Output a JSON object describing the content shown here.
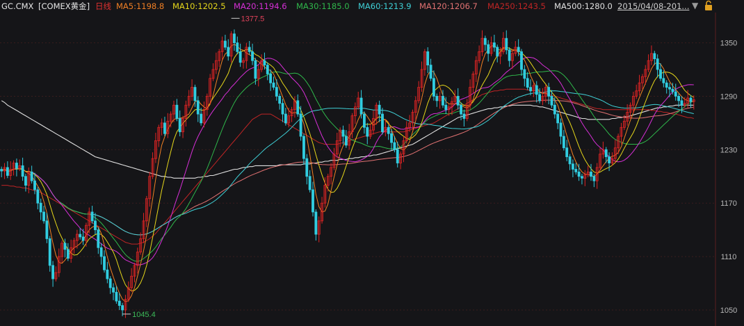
{
  "header": {
    "symbol": "GC.CMX",
    "exchange": "[COMEX黄金]",
    "period": "日线",
    "date_range": "2015/04/08-201..."
  },
  "legend": [
    {
      "label": "MA5:1198.8",
      "color": "#f07f24"
    },
    {
      "label": "MA10:1202.5",
      "color": "#e6d71b"
    },
    {
      "label": "MA20:1194.6",
      "color": "#d72fd7"
    },
    {
      "label": "MA30:1185.0",
      "color": "#2fb74b"
    },
    {
      "label": "MA60:1213.9",
      "color": "#3fd0d6"
    },
    {
      "label": "MA120:1206.7",
      "color": "#e27272"
    },
    {
      "label": "MA250:1243.5",
      "color": "#c02525"
    },
    {
      "label": "MA500:1280.0",
      "color": "#e0e0e0"
    }
  ],
  "colors": {
    "background": "#151518",
    "grid": "#3a1d1d",
    "axis_text": "#b8b8b8",
    "up": "#e02424",
    "down": "#31cde0",
    "high_label": "#e0425a",
    "low_label": "#3cbb58"
  },
  "icons": {
    "dropdown": "dropdown-triangle-icon",
    "lock": "lock-icon"
  },
  "chart_data": {
    "type": "candlestick",
    "y_ticks": [
      1050,
      1110,
      1170,
      1230,
      1290,
      1350
    ],
    "ylim": [
      1032,
      1384
    ],
    "grid": true,
    "annotations": [
      {
        "text": "1377.5",
        "kind": "period-high",
        "x_index": 76
      },
      {
        "text": "1045.4",
        "kind": "period-low",
        "x_index": 40
      }
    ],
    "series_close": [
      1206,
      1210,
      1201,
      1208,
      1215,
      1209,
      1212,
      1200,
      1190,
      1205,
      1195,
      1185,
      1170,
      1160,
      1150,
      1130,
      1100,
      1085,
      1092,
      1110,
      1125,
      1118,
      1108,
      1120,
      1128,
      1135,
      1132,
      1128,
      1145,
      1160,
      1150,
      1140,
      1120,
      1110,
      1095,
      1085,
      1075,
      1070,
      1060,
      1055,
      1050,
      1062,
      1075,
      1088,
      1100,
      1115,
      1130,
      1150,
      1175,
      1200,
      1220,
      1240,
      1255,
      1260,
      1248,
      1262,
      1270,
      1280,
      1265,
      1250,
      1265,
      1280,
      1290,
      1300,
      1285,
      1270,
      1260,
      1275,
      1290,
      1310,
      1320,
      1330,
      1340,
      1352,
      1345,
      1335,
      1360,
      1350,
      1340,
      1328,
      1330,
      1345,
      1340,
      1330,
      1310,
      1320,
      1330,
      1325,
      1315,
      1305,
      1300,
      1290,
      1282,
      1270,
      1260,
      1268,
      1275,
      1285,
      1270,
      1245,
      1220,
      1200,
      1185,
      1160,
      1135,
      1150,
      1170,
      1190,
      1200,
      1210,
      1225,
      1240,
      1252,
      1245,
      1235,
      1250,
      1268,
      1278,
      1288,
      1270,
      1255,
      1245,
      1252,
      1265,
      1280,
      1270,
      1250,
      1255,
      1248,
      1238,
      1230,
      1215,
      1225,
      1240,
      1255,
      1260,
      1272,
      1285,
      1300,
      1320,
      1340,
      1325,
      1310,
      1290,
      1285,
      1290,
      1280,
      1275,
      1278,
      1284,
      1290,
      1280,
      1270,
      1265,
      1280,
      1300,
      1315,
      1330,
      1340,
      1355,
      1348,
      1338,
      1350,
      1345,
      1335,
      1340,
      1355,
      1342,
      1330,
      1338,
      1345,
      1340,
      1320,
      1310,
      1300,
      1296,
      1302,
      1292,
      1285,
      1290,
      1300,
      1290,
      1280,
      1270,
      1260,
      1245,
      1232,
      1222,
      1214,
      1208,
      1205,
      1200,
      1198,
      1202,
      1205,
      1200,
      1195,
      1210,
      1225,
      1230,
      1222,
      1215,
      1220,
      1232,
      1245,
      1255,
      1262,
      1272,
      1280,
      1290,
      1296,
      1305,
      1312,
      1320,
      1330,
      1338,
      1332,
      1320,
      1310,
      1305,
      1300,
      1298,
      1295,
      1290,
      1285,
      1280,
      1282,
      1288,
      1284,
      1286
    ],
    "ma500": [
      1285,
      1283,
      1280,
      1278,
      1276,
      1274,
      1272,
      1270,
      1268,
      1266,
      1264,
      1262,
      1260,
      1258,
      1256,
      1254,
      1252,
      1250,
      1248,
      1246,
      1244,
      1242,
      1240,
      1238,
      1236,
      1234,
      1232,
      1230,
      1228,
      1226,
      1224,
      1222,
      1221,
      1220,
      1219,
      1218,
      1217,
      1216,
      1215,
      1214,
      1213,
      1212,
      1211,
      1210,
      1209,
      1208,
      1207,
      1206,
      1205,
      1204,
      1203,
      1202,
      1201,
      1200,
      1200,
      1199,
      1199,
      1198,
      1198,
      1198,
      1198,
      1198,
      1198,
      1198,
      1198,
      1199,
      1199,
      1200,
      1200,
      1201,
      1201,
      1202,
      1203,
      1204,
      1205,
      1206,
      1207,
      1208,
      1208,
      1209,
      1210,
      1210,
      1211,
      1211,
      1212,
      1212,
      1212,
      1212,
      1212,
      1212,
      1212,
      1212,
      1213,
      1213,
      1213,
      1213,
      1213,
      1213,
      1213,
      1213,
      1214,
      1214,
      1214,
      1215,
      1215,
      1216,
      1216,
      1217,
      1217,
      1218,
      1218,
      1218,
      1219,
      1219,
      1219,
      1220,
      1220,
      1221,
      1221,
      1222,
      1222,
      1223,
      1223,
      1224,
      1224,
      1225,
      1226,
      1227,
      1228,
      1229,
      1230,
      1231,
      1232,
      1233,
      1234,
      1235,
      1236,
      1238,
      1240,
      1242,
      1244,
      1246,
      1248,
      1250,
      1252,
      1254,
      1256,
      1258,
      1260,
      1262,
      1264,
      1266,
      1267,
      1268,
      1269,
      1270,
      1271,
      1272,
      1273,
      1274,
      1275,
      1276,
      1276,
      1277,
      1277,
      1278,
      1278,
      1279,
      1279,
      1280,
      1280,
      1280,
      1280,
      1280,
      1280,
      1280,
      1279,
      1279,
      1278,
      1278,
      1277,
      1276,
      1275,
      1274,
      1273,
      1272,
      1271,
      1270,
      1269,
      1268,
      1267,
      1266,
      1265,
      1265,
      1264,
      1264,
      1264,
      1264,
      1264,
      1264,
      1264,
      1264,
      1265,
      1265,
      1266,
      1266,
      1267,
      1267,
      1268,
      1269,
      1270,
      1271,
      1272,
      1273,
      1274,
      1275,
      1276,
      1277,
      1277,
      1278,
      1278,
      1279,
      1279,
      1280,
      1280,
      1280,
      1280,
      1280,
      1280,
      1280
    ],
    "ma250": [
      1190,
      1190,
      1190,
      1189,
      1189,
      1188,
      1188,
      1187,
      1187,
      1186,
      1185,
      1184,
      1183,
      1182,
      1180,
      1178,
      1176,
      1174,
      1172,
      1170,
      1168,
      1166,
      1164,
      1162,
      1160,
      1158,
      1156,
      1154,
      1152,
      1150,
      1148,
      1146,
      1144,
      1142,
      1140,
      1138,
      1136,
      1134,
      1132,
      1130,
      1128,
      1126,
      1125,
      1124,
      1124,
      1124,
      1125,
      1126,
      1128,
      1130,
      1133,
      1136,
      1140,
      1144,
      1148,
      1152,
      1156,
      1160,
      1164,
      1168,
      1172,
      1176,
      1180,
      1184,
      1188,
      1192,
      1196,
      1200,
      1204,
      1208,
      1212,
      1216,
      1220,
      1224,
      1228,
      1232,
      1236,
      1240,
      1244,
      1248,
      1252,
      1256,
      1260,
      1264,
      1266,
      1268,
      1270,
      1270,
      1270,
      1270,
      1268,
      1266,
      1264,
      1262,
      1260,
      1258,
      1256,
      1254,
      1252,
      1250,
      1248,
      1246,
      1244,
      1242,
      1240,
      1238,
      1237,
      1236,
      1236,
      1236,
      1236,
      1236,
      1237,
      1238,
      1239,
      1240,
      1241,
      1242,
      1243,
      1244,
      1245,
      1246,
      1247,
      1248,
      1249,
      1250,
      1250,
      1250,
      1250,
      1250,
      1250,
      1250,
      1250,
      1250,
      1251,
      1252,
      1253,
      1254,
      1255,
      1256,
      1257,
      1258,
      1259,
      1260,
      1262,
      1264,
      1266,
      1268,
      1270,
      1272,
      1274,
      1276,
      1278,
      1280,
      1282,
      1284,
      1286,
      1288,
      1290,
      1292,
      1293,
      1294,
      1295,
      1296,
      1296,
      1297,
      1297,
      1298,
      1298,
      1298,
      1298,
      1298,
      1298,
      1298,
      1297,
      1297,
      1296,
      1296,
      1295,
      1294,
      1293,
      1292,
      1291,
      1290,
      1289,
      1288,
      1287,
      1286,
      1285,
      1284,
      1283,
      1282,
      1281,
      1280,
      1279,
      1278,
      1277,
      1276,
      1276,
      1275,
      1275,
      1275,
      1275,
      1275,
      1275,
      1275,
      1275,
      1275,
      1275,
      1275,
      1275,
      1275,
      1275,
      1275,
      1275,
      1274,
      1274,
      1273,
      1273,
      1272,
      1272,
      1271,
      1270,
      1270,
      1269,
      1268,
      1267,
      1266,
      1266,
      1265
    ]
  }
}
